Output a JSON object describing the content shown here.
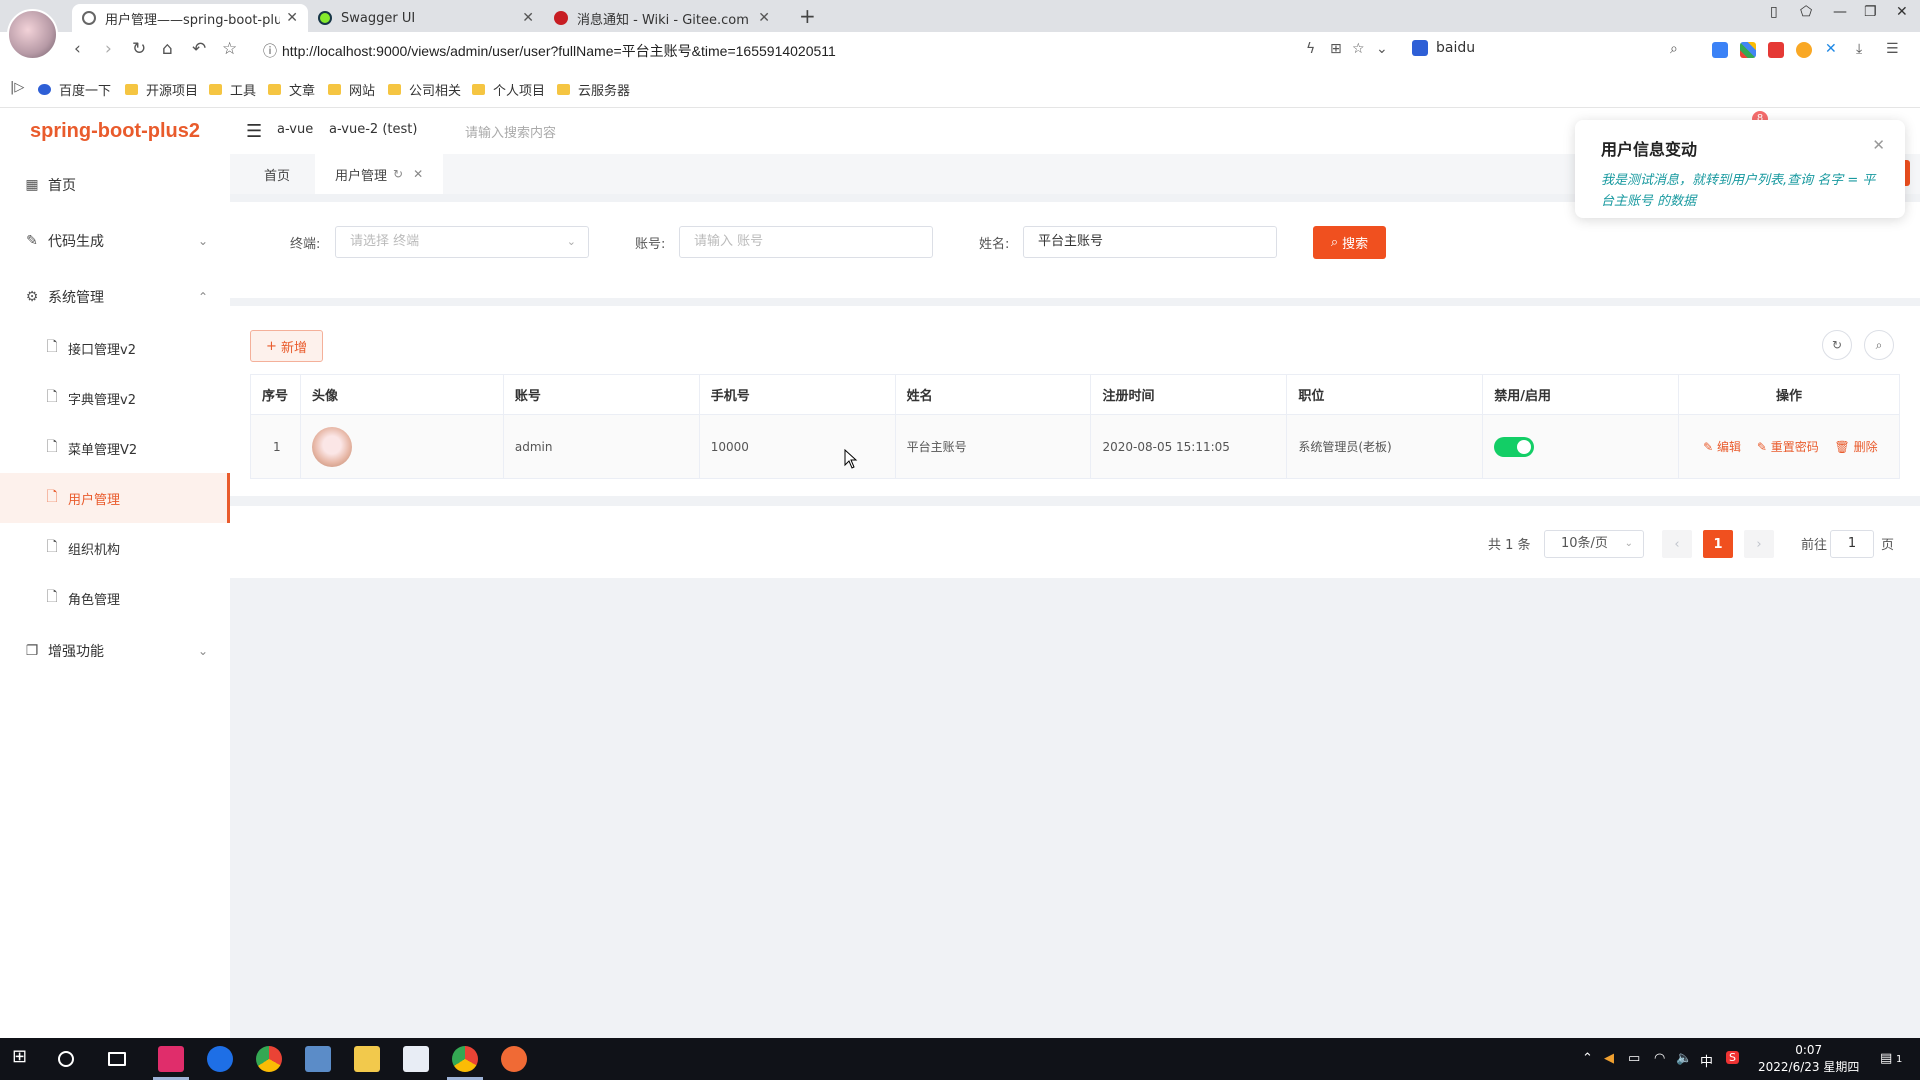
{
  "browser": {
    "tabs": [
      {
        "label": "用户管理——spring-boot-plus2",
        "active": true
      },
      {
        "label": "Swagger UI",
        "active": false
      },
      {
        "label": "消息通知 - Wiki - Gitee.com",
        "active": false
      }
    ],
    "url": "http://localhost:9000/views/admin/user/user?fullName=平台主账号&time=1655914020511",
    "search_engine": "baidu",
    "bookmarks": [
      "百度一下",
      "开源项目",
      "工具",
      "文章",
      "网站",
      "公司相关",
      "个人项目",
      "云服务器"
    ]
  },
  "app": {
    "logo": "spring-boot-plus2",
    "header": {
      "project": "a-vue",
      "env": "a-vue-2 (test)",
      "search_placeholder": "请输入搜索内容",
      "badge_count": "8"
    },
    "menu": {
      "home": "首页",
      "codegen": "代码生成",
      "system": "系统管理",
      "sub": [
        "接口管理v2",
        "字典管理v2",
        "菜单管理V2",
        "用户管理",
        "组织机构",
        "角色管理"
      ],
      "enhance": "增强功能"
    },
    "page_tabs": {
      "home": "首页",
      "current": "用户管理"
    },
    "filters": {
      "terminal_label": "终端:",
      "terminal_placeholder": "请选择 终端",
      "account_label": "账号:",
      "account_placeholder": "请输入 账号",
      "name_label": "姓名:",
      "name_value": "平台主账号",
      "search_button": "搜索"
    },
    "toolbar": {
      "add_button": "新增"
    },
    "table": {
      "headers": [
        "序号",
        "头像",
        "账号",
        "手机号",
        "姓名",
        "注册时间",
        "职位",
        "禁用/启用",
        "操作"
      ],
      "rows": [
        {
          "index": "1",
          "account": "admin",
          "phone": "10000",
          "name": "平台主账号",
          "registered": "2020-08-05 15:11:05",
          "position": "系统管理员(老板)",
          "enabled": true,
          "actions": {
            "edit": "编辑",
            "reset": "重置密码",
            "delete": "删除"
          }
        }
      ]
    },
    "pagination": {
      "total": "共 1 条",
      "page_size": "10条/页",
      "current_page": "1",
      "goto_label": "前往",
      "goto_value": "1",
      "page_suffix": "页"
    },
    "notification": {
      "title": "用户信息变动",
      "body": "我是测试消息，就转到用户列表,查询 名字 = 平台主账号 的数据"
    }
  },
  "taskbar": {
    "ime": "中",
    "time": "0:07",
    "date": "2022/6/23 星期四",
    "notification_count": "1"
  },
  "colors": {
    "accent": "#f0501f",
    "switch_on": "#13ce66",
    "notify_body": "#1a9aa0"
  }
}
